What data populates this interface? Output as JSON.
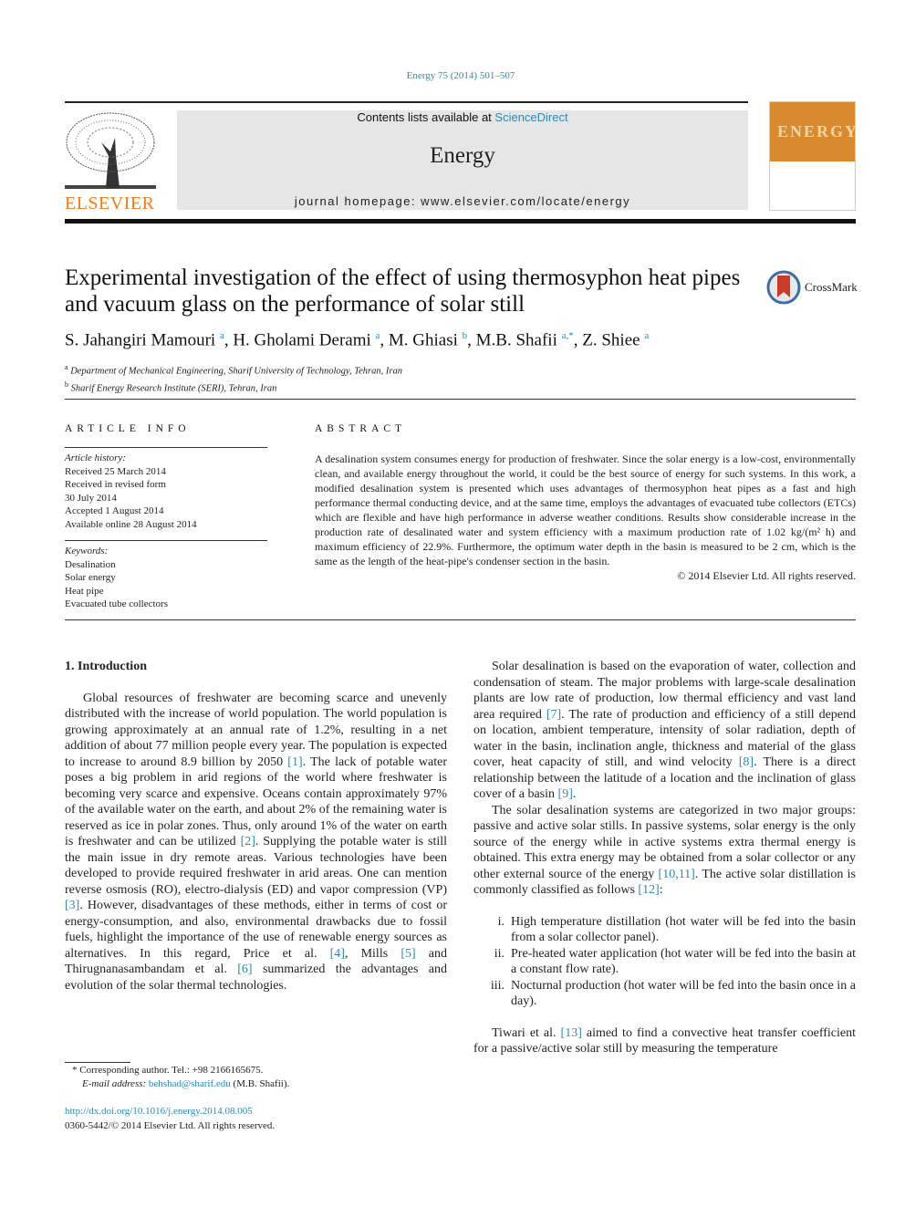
{
  "header": {
    "citation": "Energy 75 (2014) 501–507",
    "contents_prefix": "Contents lists available at ",
    "contents_link": "ScienceDirect",
    "journal": "Energy",
    "homepage": "journal homepage: www.elsevier.com/locate/energy",
    "publisher": "ELSEVIER",
    "cover_word": "ENERGY",
    "accent": "#2a8ab8",
    "publisher_color": "#f07c1c"
  },
  "article": {
    "title": "Experimental investigation of the effect of using thermosyphon heat pipes and vacuum glass on the performance of solar still",
    "crossmark": "CrossMark",
    "authors": [
      {
        "name": "S. Jahangiri Mamouri",
        "sup": "a"
      },
      {
        "name": "H. Gholami Derami",
        "sup": "a"
      },
      {
        "name": "M. Ghiasi",
        "sup": "b"
      },
      {
        "name": "M.B. Shafii",
        "sup": "a,*"
      },
      {
        "name": "Z. Shiee",
        "sup": "a"
      }
    ],
    "affiliations": [
      {
        "sup": "a",
        "text": "Department of Mechanical Engineering, Sharif University of Technology, Tehran, Iran"
      },
      {
        "sup": "b",
        "text": "Sharif Energy Research Institute (SERI), Tehran, Iran"
      }
    ]
  },
  "info": {
    "heading": "ARTICLE INFO",
    "history_label": "Article history:",
    "history": [
      "Received 25 March 2014",
      "Received in revised form",
      "30 July 2014",
      "Accepted 1 August 2014",
      "Available online 28 August 2014"
    ],
    "keywords_label": "Keywords:",
    "keywords": [
      "Desalination",
      "Solar energy",
      "Heat pipe",
      "Evacuated tube collectors"
    ]
  },
  "abstract": {
    "heading": "ABSTRACT",
    "text": "A desalination system consumes energy for production of freshwater. Since the solar energy is a low-cost, environmentally clean, and available energy throughout the world, it could be the best source of energy for such systems. In this work, a modified desalination system is presented which uses advantages of thermosyphon heat pipes as a fast and high performance thermal conducting device, and at the same time, employs the advantages of evacuated tube collectors (ETCs) which are flexible and have high performance in adverse weather conditions. Results show considerable increase in the production rate of desalinated water and system efficiency with a maximum production rate of 1.02 kg/(m² h) and maximum efficiency of 22.9%. Furthermore, the optimum water depth in the basin is measured to be 2 cm, which is the same as the length of the heat-pipe's condenser section in the basin.",
    "copyright": "© 2014 Elsevier Ltd. All rights reserved."
  },
  "body": {
    "section_title": "1.  Introduction",
    "left_paragraphs": [
      [
        {
          "t": "Global resources of freshwater are becoming scarce and unevenly distributed with the increase of world population. The world population is growing approximately at an annual rate of 1.2%, resulting in a net addition of about 77 million people every year. The population is expected to increase to around 8.9 billion by 2050 "
        },
        {
          "t": "[1]",
          "ref": true
        },
        {
          "t": ". The lack of potable water poses a big problem in arid regions of the world where freshwater is becoming very scarce and expensive. Oceans contain approximately 97% of the available water on the earth, and about 2% of the remaining water is reserved as ice in polar zones. Thus, only around 1% of the water on earth is freshwater and can be utilized "
        },
        {
          "t": "[2]",
          "ref": true
        },
        {
          "t": ". Supplying the potable water is still the main issue in dry remote areas. Various technologies have been developed to provide required freshwater in arid areas. One can mention reverse osmosis (RO), electro-dialysis (ED) and vapor compression (VP) "
        },
        {
          "t": "[3]",
          "ref": true
        },
        {
          "t": ". However, disadvantages of these methods, either in terms of cost or energy-consumption, and also, environmental drawbacks due to fossil fuels, highlight the importance of the use of renewable energy sources as alternatives. In this regard, Price et al. "
        },
        {
          "t": "[4]",
          "ref": true
        },
        {
          "t": ", Mills "
        },
        {
          "t": "[5]",
          "ref": true
        },
        {
          "t": " and Thirugnanasambandam et al. "
        },
        {
          "t": "[6]",
          "ref": true
        },
        {
          "t": " summarized the advantages and evolution of the solar thermal technologies."
        }
      ]
    ],
    "right_paragraphs": [
      [
        {
          "t": "Solar desalination is based on the evaporation of water, collection and condensation of steam. The major problems with large-scale desalination plants are low rate of production, low thermal efficiency and vast land area required "
        },
        {
          "t": "[7]",
          "ref": true
        },
        {
          "t": ". The rate of production and efficiency of a still depend on location, ambient temperature, intensity of solar radiation, depth of water in the basin, inclination angle, thickness and material of the glass cover, heat capacity of still, and wind velocity "
        },
        {
          "t": "[8]",
          "ref": true
        },
        {
          "t": ". There is a direct relationship between the latitude of a location and the inclination of glass cover of a basin "
        },
        {
          "t": "[9]",
          "ref": true
        },
        {
          "t": "."
        }
      ],
      [
        {
          "t": "The solar desalination systems are categorized in two major groups: passive and active solar stills. In passive systems, solar energy is the only source of the energy while in active systems extra thermal energy is obtained. This extra energy may be obtained from a solar collector or any other external source of the energy "
        },
        {
          "t": "[10,11]",
          "ref": true
        },
        {
          "t": ". The active solar distillation is commonly classified as follows "
        },
        {
          "t": "[12]",
          "ref": true
        },
        {
          "t": ":"
        }
      ]
    ],
    "list": [
      {
        "num": "i.",
        "text": "High temperature distillation (hot water will be fed into the basin from a solar collector panel)."
      },
      {
        "num": "ii.",
        "text": "Pre-heated water application (hot water will be fed into the basin at a constant flow rate)."
      },
      {
        "num": "iii.",
        "text": "Nocturnal production (hot water will be fed into the basin once in a day)."
      }
    ],
    "last_paragraph": [
      {
        "t": "Tiwari et al. "
      },
      {
        "t": "[13]",
        "ref": true
      },
      {
        "t": " aimed to find a convective heat transfer coefficient for a passive/active solar still by measuring the temperature"
      }
    ]
  },
  "footnote": {
    "star": "*",
    "text": "Corresponding author. Tel.: +98 2166165675.",
    "email_label": "E-mail address: ",
    "email": "behshad@sharif.edu",
    "email_suffix": " (M.B. Shafii)."
  },
  "doi": {
    "link": "http://dx.doi.org/10.1016/j.energy.2014.08.005",
    "issn": "0360-5442/© 2014 Elsevier Ltd. All rights reserved."
  }
}
